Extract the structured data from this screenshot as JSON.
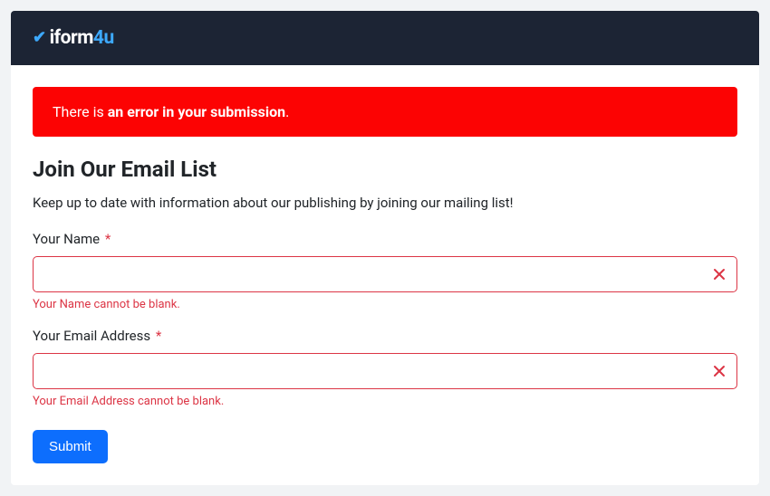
{
  "brand": {
    "check": "✔",
    "part1": "iform",
    "part2": "4u"
  },
  "alert": {
    "prefix": "There is ",
    "bold": "an error in your submission",
    "suffix": "."
  },
  "heading": "Join Our Email List",
  "subtitle": "Keep up to date with information about our publishing by joining our mailing list!",
  "fields": {
    "name": {
      "label": "Your Name",
      "required": "*",
      "value": "",
      "error": "Your Name cannot be blank."
    },
    "email": {
      "label": "Your Email Address",
      "required": "*",
      "value": "",
      "error": "Your Email Address cannot be blank."
    }
  },
  "submit_label": "Submit"
}
